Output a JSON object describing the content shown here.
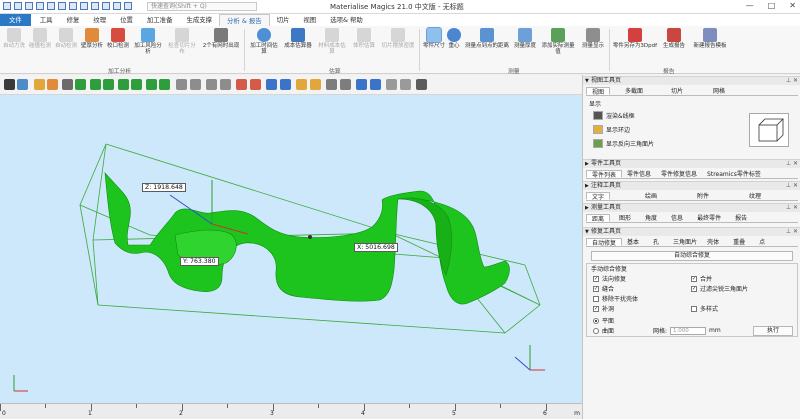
{
  "titlebar": {
    "title": "Materialise Magics 21.0 中文版 - 无标题",
    "search_placeholder": "快速查询(Shift + Q)",
    "min": "—",
    "max": "□",
    "close": "✕"
  },
  "menu_tabs": [
    {
      "label": "文件"
    },
    {
      "label": "工具"
    },
    {
      "label": "修复"
    },
    {
      "label": "纹理"
    },
    {
      "label": "位置"
    },
    {
      "label": "加工准备"
    },
    {
      "label": "生成支撑"
    },
    {
      "label": "分析 & 报告"
    },
    {
      "label": "切片"
    },
    {
      "label": "视图"
    },
    {
      "label": "选项& 帮助"
    }
  ],
  "ribbon": {
    "buttons": [
      {
        "label": "自动力洗",
        "state": "disabled"
      },
      {
        "label": "碰撞检测",
        "state": "disabled"
      },
      {
        "label": "自动检测",
        "state": "disabled"
      },
      {
        "label": "壁厚分析",
        "state": "enabled"
      },
      {
        "label": "校口检测",
        "state": "enabled"
      },
      {
        "label": "加工风险分析",
        "state": "enabled"
      },
      {
        "label": "检查切片分布",
        "state": "disabled"
      },
      {
        "label": "2个有网时出现",
        "state": "enabled"
      },
      {
        "label": "加工时间估算",
        "state": "enabled"
      },
      {
        "label": "成本估算器",
        "state": "enabled"
      },
      {
        "label": "材料成本估算",
        "state": "disabled"
      },
      {
        "label": "体积估算",
        "state": "disabled"
      },
      {
        "label": "切片摆放密度",
        "state": "disabled"
      },
      {
        "label": "零件尺寸",
        "state": "selected"
      },
      {
        "label": "重心",
        "state": "enabled"
      },
      {
        "label": "测量点到点的距离",
        "state": "enabled"
      },
      {
        "label": "测量厚度",
        "state": "enabled"
      },
      {
        "label": "添加实际测量值",
        "state": "enabled"
      },
      {
        "label": "测量显示",
        "state": "enabled"
      },
      {
        "label": "零件另存为3Dpdf",
        "state": "enabled"
      },
      {
        "label": "生成报告",
        "state": "enabled"
      },
      {
        "label": "新建报告模板",
        "state": "enabled"
      }
    ],
    "groups": {
      "analysis": "加工分析",
      "estimate": "估算",
      "measure": "测量",
      "report": "报告"
    }
  },
  "viewport": {
    "measure_z": "Z: 1918.648",
    "measure_y": "Y: 763.380",
    "measure_x": "X: 5016.698"
  },
  "ruler": {
    "labels": [
      "0",
      "1",
      "2",
      "3",
      "4",
      "5",
      "6"
    ],
    "unit": "m"
  },
  "panel": {
    "view_toolpage": {
      "header": "视图工具页",
      "tabs": [
        "视图",
        "多截面",
        "切片",
        "网格"
      ],
      "section": "显示",
      "rows": [
        "渲染&线框",
        "显示环边",
        "显示反向三角面片"
      ]
    },
    "part_toolpage": {
      "header": "零件工具页",
      "tabs": [
        "零件列表",
        "零件信息",
        "零件修复信息",
        "Streamics零件标签"
      ]
    },
    "annotation_toolpage": {
      "header": "注释工具页",
      "tabs": [
        "文字",
        "绘画",
        "附件",
        "纹理"
      ]
    },
    "measure_toolpage": {
      "header": "测量工具页",
      "tabs": [
        "距离",
        "图形",
        "角度",
        "信息",
        "最终零件",
        "报告"
      ]
    },
    "repair_toolpage": {
      "header": "修复工具页",
      "tabs": [
        "自动修复",
        "基本",
        "孔",
        "三角面片",
        "壳体",
        "重叠",
        "点"
      ],
      "auto_title": "自动综合修复",
      "manual_title": "手动综合修复",
      "checks": [
        {
          "label": "法向修复",
          "checked": true
        },
        {
          "label": "合并",
          "checked": true
        },
        {
          "label": "缝合",
          "checked": true
        },
        {
          "label": "过滤尖锐三角面片",
          "checked": true
        },
        {
          "label": "移除干扰壳体",
          "checked": false
        },
        {
          "label": "补洞",
          "checked": true
        },
        {
          "label": "多样式",
          "checked": false
        }
      ],
      "radio_plane": "平面",
      "radio_surface": "曲面",
      "grid_label": "网格:",
      "grid_value": "1.000",
      "grid_unit": "mm",
      "run_button": "执行"
    }
  },
  "colors": {
    "viewport_bg": "#cce8fa",
    "model_green": "#1ec41e",
    "bbox_green": "#3aa83a",
    "file_tab": "#2b78c5"
  }
}
